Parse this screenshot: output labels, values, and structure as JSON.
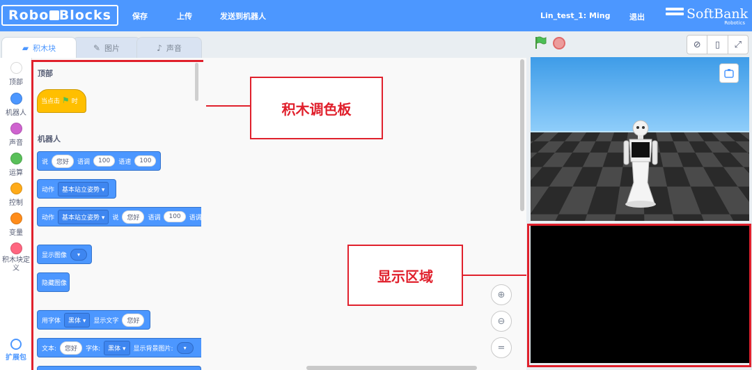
{
  "header": {
    "logo_left": "Robo",
    "logo_right": "Blocks",
    "menu": [
      "保存",
      "上传",
      "发送到机器人"
    ],
    "user": "Lin_test_1: Ming",
    "logout": "退出",
    "brand": "SoftBank",
    "brand_sub": "Robotics",
    "bg_color": "#4c97ff"
  },
  "tabs": [
    {
      "label": "积木块",
      "icon": "blocks-icon",
      "active": true
    },
    {
      "label": "图片",
      "icon": "brush-icon",
      "active": false
    },
    {
      "label": "声音",
      "icon": "speaker-icon",
      "active": false
    }
  ],
  "categories": [
    {
      "label": "顶部",
      "color": "#ffffff"
    },
    {
      "label": "机器人",
      "color": "#4c97ff"
    },
    {
      "label": "声音",
      "color": "#cf63cf"
    },
    {
      "label": "运算",
      "color": "#59c059"
    },
    {
      "label": "控制",
      "color": "#ffab19"
    },
    {
      "label": "变量",
      "color": "#ff8c1a"
    },
    {
      "label": "积木块定义",
      "color": "#ff6680"
    }
  ],
  "extensions_label": "扩展包",
  "palette": {
    "section_top": "顶部",
    "hat_prefix": "当点击",
    "hat_suffix": "时",
    "section_robot": "机器人",
    "say": {
      "label": "说",
      "text": "您好",
      "pitch_label": "语调",
      "pitch": "100",
      "speed_label": "语速",
      "speed": "100"
    },
    "motion1": {
      "label": "动作",
      "pose": "基本站立姿势"
    },
    "motion2": {
      "label": "动作",
      "pose": "基本站立姿势",
      "say_label": "说",
      "text": "您好",
      "pitch_label": "语调",
      "pitch": "100",
      "trail": "语调"
    },
    "show_image": "显示图像",
    "hide_image": "隐藏图像",
    "font_block": {
      "label": "用字体",
      "font": "黑体",
      "show_text": "显示文字",
      "text": "您好"
    },
    "text_block": {
      "label": "文本:",
      "text": "您好",
      "font_label": "字体:",
      "font": "黑体",
      "bg_label": "显示背景图片:"
    }
  },
  "annotations": {
    "palette_label": "积木调色板",
    "display_label": "显示区域",
    "color": "#e0202c"
  }
}
